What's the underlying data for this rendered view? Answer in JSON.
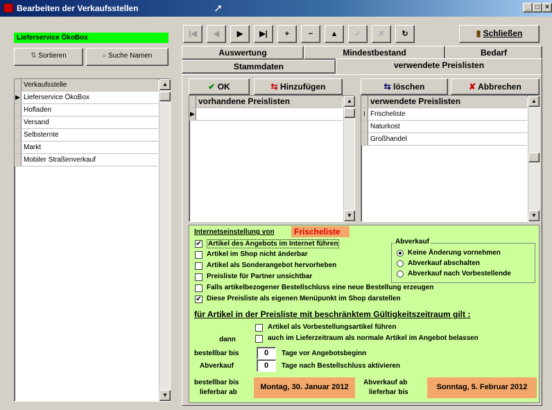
{
  "window": {
    "title": "Bearbeiten der Verkaufsstellen"
  },
  "left": {
    "current": "Lieferservice ÖkoBox",
    "sort_label": "Sortieren",
    "search_label": "Suche Namen",
    "grid_header": "Verkaufsstelle",
    "rows": [
      "Lieferservice ÖkoBox",
      "Hofladen",
      "Versand",
      "Selbsternte",
      "Markt",
      "Mobiler Straßenverkauf"
    ],
    "row_indicator": "▶"
  },
  "nav": {
    "close_label": "Schließen"
  },
  "tabs": {
    "row1": [
      "Auswertung",
      "Mindestbestand",
      "Bedarf"
    ],
    "row2": [
      "Stammdaten",
      "verwendete Preislisten"
    ],
    "active": "verwendete Preislisten"
  },
  "actions": {
    "ok": "OK",
    "add": "Hinzufügen",
    "delete": "löschen",
    "cancel": "Abbrechen"
  },
  "available_lists": {
    "header": "vorhandene Preislisten",
    "rows": [
      ""
    ]
  },
  "used_lists": {
    "header": "verwendete Preislisten",
    "rows": [
      "Frischeliste",
      "Naturkost",
      "Großhandel"
    ]
  },
  "internet": {
    "heading": "Internetseinstellung von",
    "list_name": "Frischeliste",
    "options": [
      {
        "label": "Artikel des Angebots im Internet führen",
        "checked": true
      },
      {
        "label": "Artikel im Shop nicht änderbar",
        "checked": false
      },
      {
        "label": "Artikel als Sonderangebot hervorheben",
        "checked": false
      },
      {
        "label": "Preisliste für Partner unsichtbar",
        "checked": false
      },
      {
        "label": "Falls artikelbezogener Bestellschluss eine neue Bestellung erzeugen",
        "checked": false
      },
      {
        "label": "Diese Preisliste als eigenen Menüpunkt im Shop darstellen",
        "checked": true
      }
    ],
    "abverkauf": {
      "title": "Abverkauf",
      "options": [
        {
          "label": "Keine Änderung vornehmen",
          "selected": true
        },
        {
          "label": "Abverkauf abschalten",
          "selected": false
        },
        {
          "label": "Abverkauf nach Vorbestellende",
          "selected": false
        }
      ]
    }
  },
  "validity": {
    "heading": "für Artikel in der Preisliste mit beschränktem Gültigkeitszeitraum gilt :",
    "then_label": "dann",
    "opt1": "Artikel als Vorbestellungsartikel führen",
    "opt2": "auch im Lieferzeitraum als normale Artikel im  Angebot belassen",
    "orderable_until": "bestellbar bis",
    "orderable_value": "0",
    "orderable_suffix": "Tage vor Angebotsbeginn",
    "sellout": "Abverkauf",
    "sellout_value": "0",
    "sellout_suffix": "Tage nach Bestellschluss aktivieren",
    "date_label_1a": "bestellbar bis",
    "date_label_1b": "lieferbar ab",
    "date_value_1": "Montag, 30. Januar 2012",
    "date_label_2a": "Abverkauf ab",
    "date_label_2b": "lieferbar bis",
    "date_value_2": "Sonntag, 5. Februar 2012"
  },
  "colors": {
    "green_panel": "#ccff99",
    "green_bar": "#00ff00",
    "orange": "#f3a76a",
    "title_blue": "#0a246a"
  }
}
